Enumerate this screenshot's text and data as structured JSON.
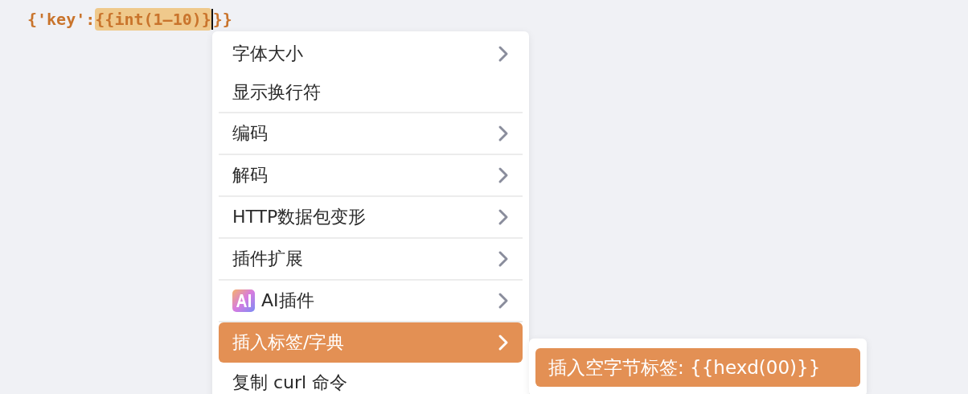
{
  "editor": {
    "segments": [
      {
        "text": "{'key':",
        "selected": false
      },
      {
        "text": "{{int(1–10)}",
        "selected": true
      },
      {
        "text": "}}",
        "selected": false
      }
    ]
  },
  "context_menu": {
    "items": [
      {
        "kind": "item",
        "label": "字体大小",
        "submenu": true,
        "selected": false
      },
      {
        "kind": "item",
        "label": "显示换行符",
        "submenu": false,
        "selected": false
      },
      {
        "kind": "separator"
      },
      {
        "kind": "item",
        "label": "编码",
        "submenu": true,
        "selected": false
      },
      {
        "kind": "separator"
      },
      {
        "kind": "item",
        "label": "解码",
        "submenu": true,
        "selected": false
      },
      {
        "kind": "separator"
      },
      {
        "kind": "item",
        "label": "HTTP数据包变形",
        "submenu": true,
        "selected": false
      },
      {
        "kind": "separator"
      },
      {
        "kind": "item",
        "label": "插件扩展",
        "submenu": true,
        "selected": false
      },
      {
        "kind": "separator"
      },
      {
        "kind": "ai",
        "label": "AI插件",
        "submenu": true,
        "selected": false
      },
      {
        "kind": "separator"
      },
      {
        "kind": "item",
        "label": "插入标签/字典",
        "submenu": true,
        "selected": true
      },
      {
        "kind": "item",
        "label": "复制 curl 命令",
        "submenu": false,
        "selected": false
      }
    ]
  },
  "submenu": {
    "items": [
      {
        "label": "插入空字节标签: {{hexd(00)}}",
        "selected": true
      }
    ]
  }
}
